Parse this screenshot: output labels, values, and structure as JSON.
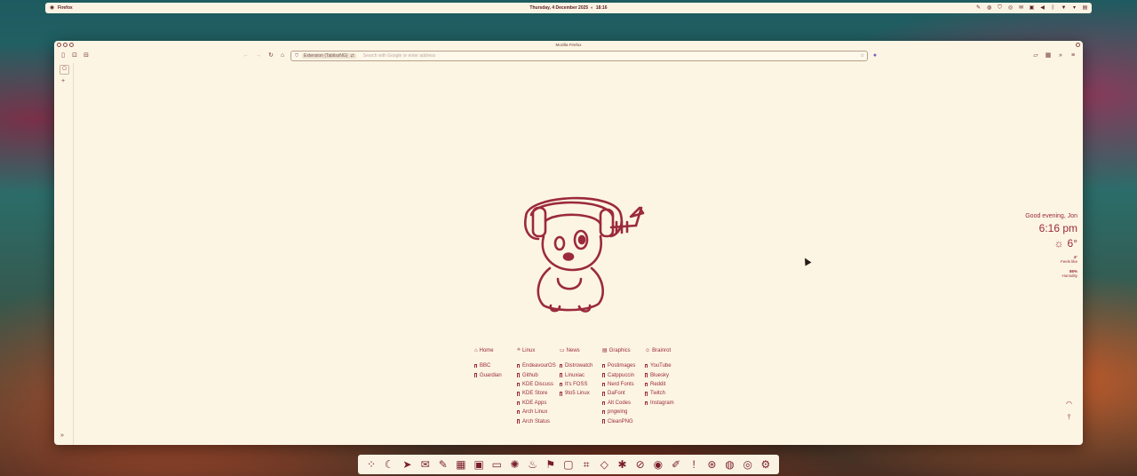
{
  "top_panel": {
    "app_name": "Firefox",
    "clock": "Thursday, 4 December 2025",
    "time": "18:16",
    "tray_icons": [
      "pen-icon",
      "globe-icon",
      "shield-icon",
      "steam-icon",
      "mail-icon",
      "notes-icon",
      "volume-icon",
      "bluetooth-icon",
      "wifi-icon",
      "chevron-down-icon",
      "inbox-icon"
    ]
  },
  "window": {
    "title": "Mozilla Firefox",
    "urlbar": {
      "extension_label": "Extension (TablissNG)",
      "placeholder": "Search with Google or enter address"
    }
  },
  "greeting": {
    "hello": "Good evening, Jon",
    "time": "6:16 pm",
    "temp": "6°",
    "feels_like_value": "4°",
    "feels_like_label": "Feels like",
    "humidity_value": "86%",
    "humidity_label": "Humidity"
  },
  "links": [
    {
      "head": "Home",
      "items": [
        "BBC",
        "Guardian"
      ]
    },
    {
      "head": "Linux",
      "items": [
        "EndeavourOS",
        "Github",
        "KDE Discuss",
        "KDE Store",
        "KDE Apps",
        "Arch Linux",
        "Arch Status"
      ]
    },
    {
      "head": "News",
      "items": [
        "Distrowatch",
        "Linuxiac",
        "It's FOSS",
        "9to5 Linux"
      ]
    },
    {
      "head": "Graphics",
      "items": [
        "Postimages",
        "Catppuccin",
        "Nerd Fonts",
        "DaFont",
        "Alt Codes",
        "pngwing",
        "CleanPNG"
      ]
    },
    {
      "head": "Brainrot",
      "items": [
        "YouTube",
        "Bluesky",
        "Reddit",
        "Twitch",
        "Instagram"
      ]
    }
  ],
  "dock": {
    "apps": [
      "launcher-icon",
      "night-icon",
      "telegram-icon",
      "mail-icon",
      "edit-icon",
      "calendar-icon",
      "libreoffice-icon",
      "files-icon",
      "aperture-icon",
      "flame-icon",
      "flag-icon",
      "display-icon",
      "hash-icon",
      "fish-icon",
      "bug-icon",
      "disk-icon",
      "blender-icon",
      "eyedropper-icon",
      "alert-icon",
      "steam-icon",
      "obs-icon",
      "webcam-icon",
      "settings-icon"
    ]
  },
  "colors": {
    "accent": "#9b2a3a",
    "background": "#fcf5e4"
  }
}
